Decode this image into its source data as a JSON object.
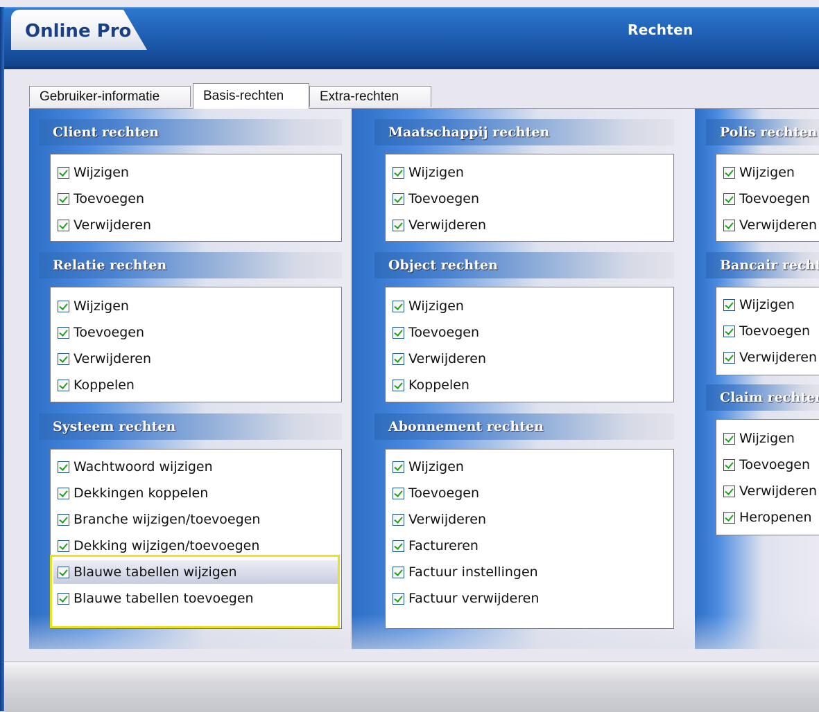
{
  "app": {
    "name": "Online Pro",
    "window_title": "Rechten"
  },
  "tabs": [
    {
      "label": "Gebruiker-informatie",
      "active": false
    },
    {
      "label": "Basis-rechten",
      "active": true
    },
    {
      "label": "Extra-rechten",
      "active": false
    }
  ],
  "columns": [
    {
      "groups": [
        {
          "title": "Client rechten",
          "items": [
            {
              "label": "Wijzigen",
              "checked": true
            },
            {
              "label": "Toevoegen",
              "checked": true
            },
            {
              "label": "Verwijderen",
              "checked": true
            }
          ]
        },
        {
          "title": "Relatie rechten",
          "items": [
            {
              "label": "Wijzigen",
              "checked": true
            },
            {
              "label": "Toevoegen",
              "checked": true
            },
            {
              "label": "Verwijderen",
              "checked": true
            },
            {
              "label": "Koppelen",
              "checked": true
            }
          ]
        },
        {
          "title": "Systeem rechten",
          "items": [
            {
              "label": "Wachtwoord wijzigen",
              "checked": true
            },
            {
              "label": "Dekkingen koppelen",
              "checked": true
            },
            {
              "label": "Branche wijzigen/toevoegen",
              "checked": true
            },
            {
              "label": "Dekking wijzigen/toevoegen",
              "checked": true
            },
            {
              "label": "Blauwe tabellen wijzigen",
              "checked": true,
              "highlighted": true
            },
            {
              "label": "Blauwe tabellen toevoegen",
              "checked": true
            }
          ]
        }
      ]
    },
    {
      "groups": [
        {
          "title": "Maatschappij rechten",
          "items": [
            {
              "label": "Wijzigen",
              "checked": true
            },
            {
              "label": "Toevoegen",
              "checked": true
            },
            {
              "label": "Verwijderen",
              "checked": true
            }
          ]
        },
        {
          "title": "Object rechten",
          "items": [
            {
              "label": "Wijzigen",
              "checked": true
            },
            {
              "label": "Toevoegen",
              "checked": true
            },
            {
              "label": "Verwijderen",
              "checked": true
            },
            {
              "label": "Koppelen",
              "checked": true
            }
          ]
        },
        {
          "title": "Abonnement rechten",
          "items": [
            {
              "label": "Wijzigen",
              "checked": true
            },
            {
              "label": "Toevoegen",
              "checked": true
            },
            {
              "label": "Verwijderen",
              "checked": true
            },
            {
              "label": "Factureren",
              "checked": true
            },
            {
              "label": "Factuur instellingen",
              "checked": true
            },
            {
              "label": "Factuur verwijderen",
              "checked": true
            }
          ]
        }
      ]
    },
    {
      "groups": [
        {
          "title": "Polis rechten",
          "items": [
            {
              "label": "Wijzigen",
              "checked": true
            },
            {
              "label": "Toevoegen",
              "checked": true
            },
            {
              "label": "Verwijderen",
              "checked": true
            }
          ]
        },
        {
          "title": "Bancair rechten",
          "items": [
            {
              "label": "Wijzigen",
              "checked": true
            },
            {
              "label": "Toevoegen",
              "checked": true
            },
            {
              "label": "Verwijderen",
              "checked": true
            }
          ]
        },
        {
          "title": "Claim rechten",
          "items": [
            {
              "label": "Wijzigen",
              "checked": true
            },
            {
              "label": "Toevoegen",
              "checked": true
            },
            {
              "label": "Verwijderen",
              "checked": true
            },
            {
              "label": "Heropenen",
              "checked": true
            }
          ]
        }
      ]
    }
  ]
}
